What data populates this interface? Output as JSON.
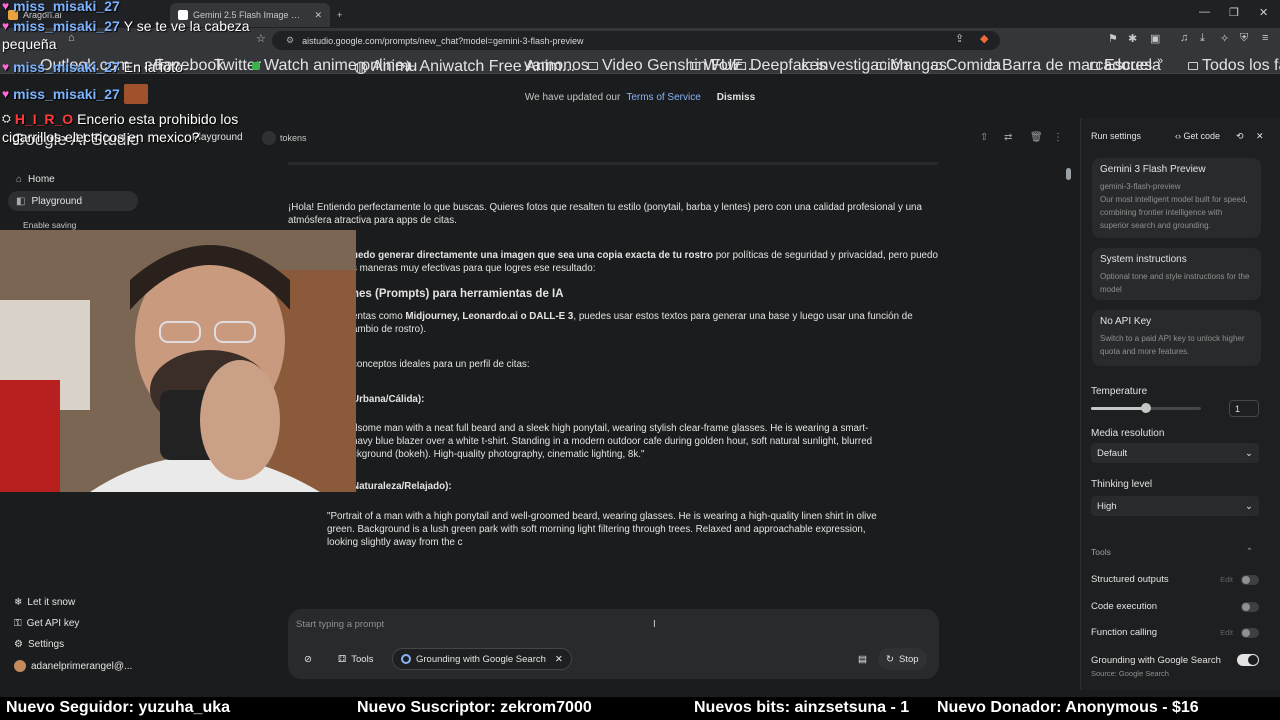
{
  "browser": {
    "tab_background_label": "Aragon.ai",
    "tab_active_label": "Gemini 2.5 Flash Image (Nano B...",
    "new_tab_label": "+",
    "url": "aistudio.google.com/prompts/new_chat?model=gemini-3-flash-preview",
    "bookmarks": [
      "Outlook.com - adan...",
      "Facebook",
      "Twitter",
      "Watch anime online...",
      "Animu",
      "Aniwatch Free Anim...",
      "vamonos",
      "Video Genshin FUE...",
      "Wow",
      "Deepfakes",
      "investigación",
      "Mangas",
      "Comida",
      "Barra de marcadores",
      "Escuela"
    ],
    "bookmarks_overflow": "»",
    "all_bookmarks": "Todos los favoritos"
  },
  "banner": {
    "text": "We have updated our",
    "link": "Terms of Service",
    "dismiss": "Dismiss"
  },
  "app": {
    "logo": "Google AI Studio",
    "tab": "Playground",
    "tokens": "tokens"
  },
  "sidebar": {
    "items": [
      "Home",
      "Playground"
    ],
    "enable_saving": "Enable saving",
    "bottom": [
      "Let it snow",
      "Get API key",
      "Settings",
      "adanelprimerangel@..."
    ]
  },
  "chat": {
    "p1": "¡Hola! Entiendo perfectamente lo que buscas. Quieres fotos que resalten tu estilo (ponytail, barba y lentes) pero con una calidad profesional y una atmósfera atractiva para apps de citas.",
    "p2_bold": "uedo generar directamente una imagen que sea una copia exacta de tu rostro",
    "p2_rest": " por políticas de seguridad y privacidad, pero puedo",
    "p2_line2": "s maneras muy efectivas para que logres ese resultado:",
    "h1": "nes (Prompts) para herramientas de IA",
    "p3_a": "entas como ",
    "p3_bold": "Midjourney, Leonardo.ai o DALL-E 3",
    "p3_b": ", puedes usar estos textos para generar una base y luego usar una función de",
    "p3_line2": "ambio de rostro).",
    "p4": "conceptos ideales para un perfil de citas:",
    "h2": "Urbana/Cálida):",
    "p5_l1": "dsome man with a neat full beard and a sleek high ponytail, wearing stylish clear-frame glasses. He is wearing a smart-",
    "p5_l2": " navy blue blazer over a white t-shirt. Standing in a modern outdoor cafe during golden hour, soft natural sunlight, blurred",
    "p5_l3": "ckground (bokeh). High-quality photography, cinematic lighting, 8k.\"",
    "h3": "Naturaleza/Relajado):",
    "p6": "\"Portrait of a man with a high ponytail and well-groomed beard, wearing glasses. He is wearing a high-quality linen shirt in olive green. Background is a lush green park with soft morning light filtering through trees. Relaxed and approachable expression, looking slightly away from the c"
  },
  "prompt": {
    "placeholder": "Start typing a prompt",
    "tools": "Tools",
    "grounding": "Grounding with Google Search",
    "stop": "Stop"
  },
  "right_panel": {
    "title": "Run settings",
    "get_code": "Get code",
    "model_name": "Gemini 3 Flash Preview",
    "model_id": "gemini-3-flash-preview",
    "model_desc": "Our most intelligent model built for speed, combining frontier intelligence with superior search and grounding.",
    "sys_title": "System instructions",
    "sys_desc": "Optional tone and style instructions for the model",
    "api_title": "No API Key",
    "api_desc": "Switch to a paid API key to unlock higher quota and more features.",
    "temperature_label": "Temperature",
    "temperature_value": "1",
    "temperature_fraction": 0.5,
    "media_label": "Media resolution",
    "media_value": "Default",
    "thinking_label": "Thinking level",
    "thinking_value": "High",
    "tools_label": "Tools",
    "edit": "Edit",
    "tools": [
      "Structured outputs",
      "Code execution",
      "Function calling",
      "Grounding with Google Search"
    ],
    "grounding_source": "Source: Google Search"
  },
  "overlay": {
    "chat": [
      {
        "user": "miss_misaki_27",
        "msg": "Y se te ve la cabeza"
      },
      {
        "user": "",
        "msg": "pequeña"
      },
      {
        "user": "miss_misaki_27",
        "msg": "En la foto"
      },
      {
        "user": "miss_misaki_27",
        "msg": ""
      },
      {
        "user": "H_I_R_O",
        "msg": "Encerio esta prohibido los"
      },
      {
        "user": "",
        "msg": "cigarrillos electricos en mexico?"
      }
    ],
    "ticker": [
      "Nuevo Seguidor: yuzuha_uka",
      "Nuevo Suscriptor: zekrom7000",
      "Nuevos bits: ainzsetsuna - 1",
      "Nuevo Donador: Anonymous - $16"
    ]
  },
  "colors": {
    "accent_link": "#8ab4f8",
    "bg": "#1b1c1d",
    "panel": "#1e1f20",
    "card": "#282a2c"
  }
}
